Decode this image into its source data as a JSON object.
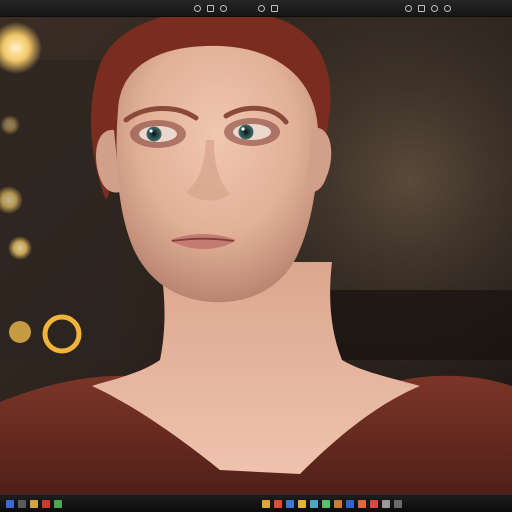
{
  "image": {
    "kind": "photo-like render",
    "subject": "portrait"
  },
  "colors": {
    "background": "#2a1f1a",
    "skin": "#e7b9a0",
    "hair": "#7a2d1f",
    "dress": "#6a2a22",
    "bokeh": "#f2c768"
  },
  "icons": {
    "top": [
      "window-control-icon",
      "app-icon",
      "status-icon"
    ],
    "taskbar": [
      "start-icon",
      "folder-icon",
      "browser-icon",
      "mail-icon",
      "app-icon"
    ]
  }
}
